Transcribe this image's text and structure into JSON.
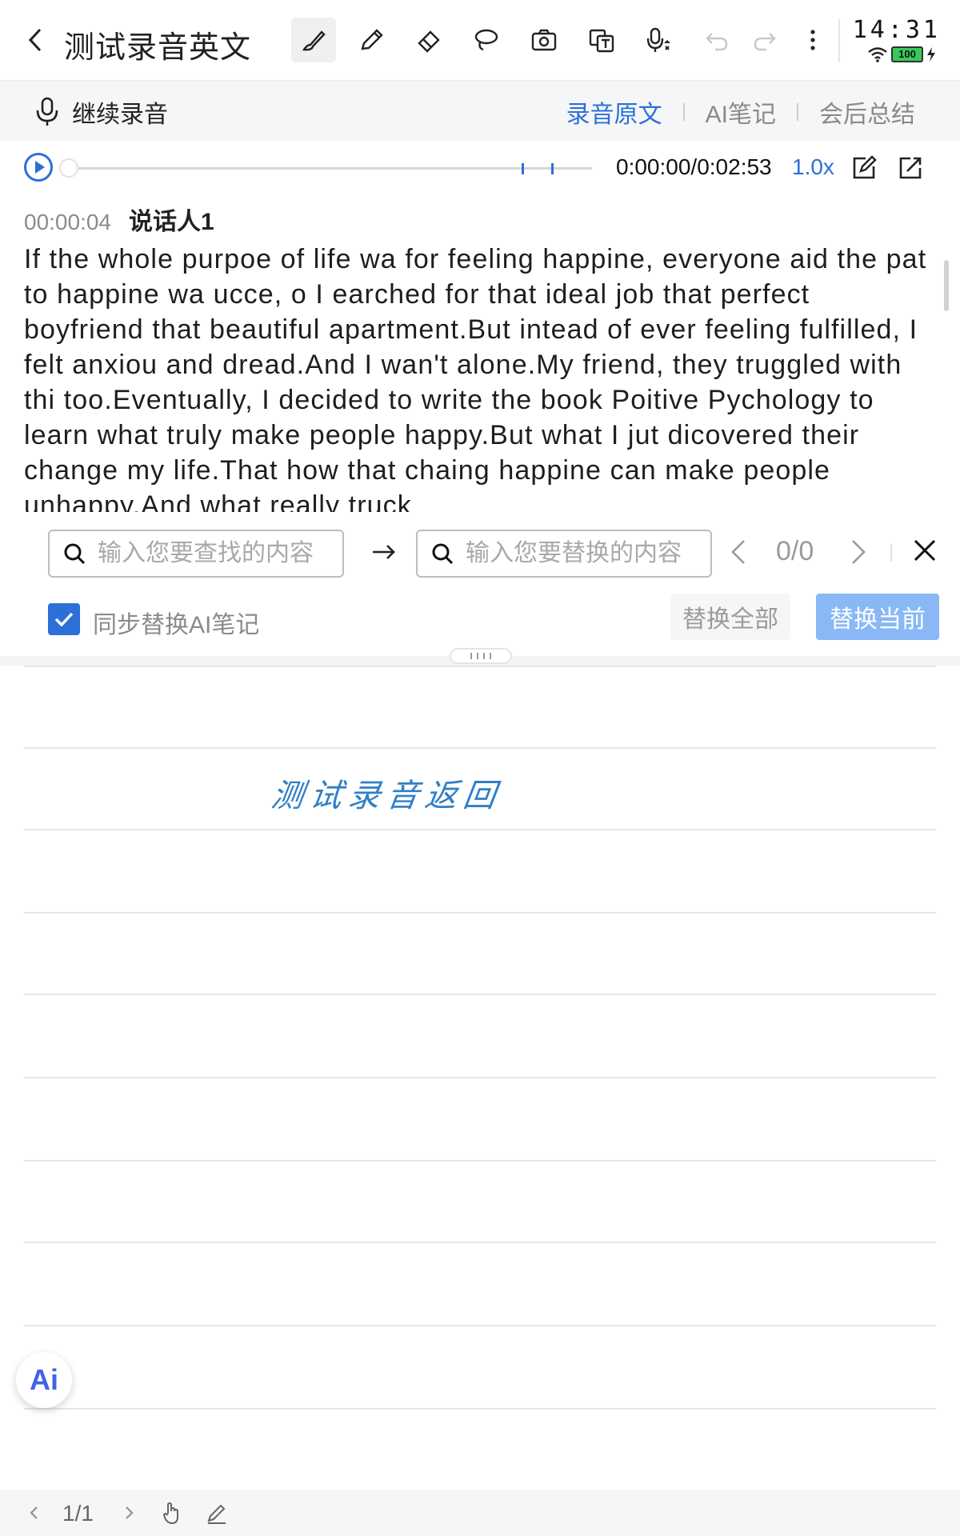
{
  "header": {
    "title": "测试录音英文",
    "status_time": "14:31",
    "battery": "100"
  },
  "toolbar": {
    "tools": [
      "brush-icon",
      "pen-icon",
      "eraser-icon",
      "lasso-icon",
      "camera-icon",
      "translate-icon",
      "voice-input-icon",
      "undo-icon",
      "redo-icon",
      "more-icon"
    ],
    "active_tool": "brush-icon"
  },
  "subbar": {
    "continue_recording": "继续录音",
    "tabs": [
      {
        "label": "录音原文",
        "active": true
      },
      {
        "label": "AI笔记",
        "active": false
      },
      {
        "label": "会后总结",
        "active": false
      }
    ]
  },
  "player": {
    "timecode": "0:00:00/0:02:53",
    "speed": "1.0x",
    "progress": 0.0
  },
  "transcript": {
    "timestamp": "00:00:04",
    "speaker": "说话人1",
    "text": "If the whole purpoe of life wa for feeling happine, everyone aid the pat to happine wa ucce, o I earched for that ideal job that perfect boyfriend that beautiful apartment.But intead of ever feeling fulfilled, I felt anxiou and dread.And I wan't alone.My friend, they truggled with thi too.Eventually, I decided to write the book Poitive Pychology to learn what truly make people happy.But what I jut dicovered their change my life.That how that chaing happine can make people unhappy.And what really truck"
  },
  "find_replace": {
    "find_placeholder": "输入您要查找的内容",
    "replace_placeholder": "输入您要替换的内容",
    "count": "0/0",
    "sync_label": "同步替换AI笔记",
    "sync_checked": true,
    "replace_all": "替换全部",
    "replace_current": "替换当前"
  },
  "notes": {
    "handwriting": "测试录音返回"
  },
  "ai_button": "Ai",
  "bottom": {
    "page_indicator": "1/1"
  },
  "colors": {
    "accent": "#2d6fd8",
    "accent_disabled": "#8ab8f6",
    "handwriting": "#2f7fc7"
  }
}
